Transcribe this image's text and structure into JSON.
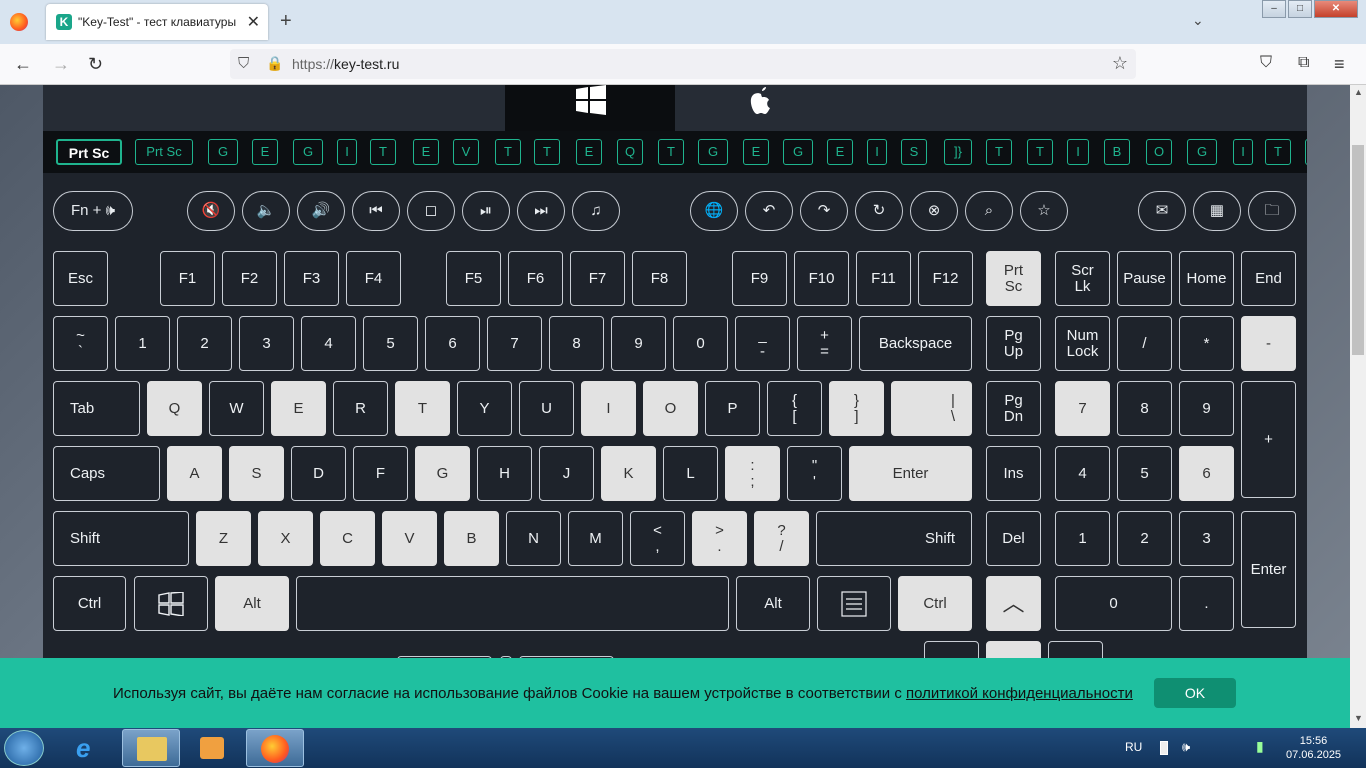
{
  "browser": {
    "tab_title": "\"Key-Test\" - тест клавиатуры",
    "tab_favicon": "K",
    "url_proto": "https://",
    "url_host": "key-test.ru"
  },
  "keystrip": [
    "Prt Sc",
    "Prt Sc",
    "G",
    "E",
    "G",
    "I",
    "T",
    "E",
    "V",
    "T",
    "T",
    "E",
    "Q",
    "T",
    "G",
    "E",
    "G",
    "E",
    "I",
    "S",
    "]}",
    "T",
    "T",
    "I",
    "B",
    "O",
    "G",
    "I",
    "T"
  ],
  "fn_label": "Fn + 🕪",
  "function_row": [
    {
      "label": "Esc"
    },
    {
      "label": "F1"
    },
    {
      "label": "F2"
    },
    {
      "label": "F3"
    },
    {
      "label": "F4"
    },
    {
      "label": "F5"
    },
    {
      "label": "F6"
    },
    {
      "label": "F7"
    },
    {
      "label": "F8"
    },
    {
      "label": "F9"
    },
    {
      "label": "F10"
    },
    {
      "label": "F11"
    },
    {
      "label": "F12"
    },
    {
      "label": "Prt\nSc"
    },
    {
      "label": "Scr\nLk"
    },
    {
      "label": "Pause"
    },
    {
      "label": "Home"
    },
    {
      "label": "End"
    }
  ],
  "number_row": [
    "~\n`",
    "1",
    "2",
    "3",
    "4",
    "5",
    "6",
    "7",
    "8",
    "9",
    "0",
    "_\n-",
    "+\n=",
    "Backspace",
    "Pg\nUp",
    "Num\nLock",
    "/",
    "*",
    "-"
  ],
  "q_row": [
    "Tab",
    "Q",
    "W",
    "E",
    "R",
    "T",
    "Y",
    "U",
    "I",
    "O",
    "P",
    "{\n[",
    "}\n]",
    "|\n\\",
    "Pg\nDn",
    "7",
    "8",
    "9",
    "+"
  ],
  "a_row": [
    "Caps",
    "A",
    "S",
    "D",
    "F",
    "G",
    "H",
    "J",
    "K",
    "L",
    ":\n;",
    "\"\n'",
    "Enter",
    "Ins",
    "4",
    "5",
    "6"
  ],
  "z_row": [
    "Shift",
    "Z",
    "X",
    "C",
    "V",
    "B",
    "N",
    "M",
    "<\n,",
    ">\n.",
    "?\n/",
    "Shift",
    "Del",
    "1",
    "2",
    "3",
    "Enter"
  ],
  "bottom_row": [
    "Ctrl",
    "",
    "Alt",
    "",
    "Alt",
    "",
    "Ctrl",
    "",
    "0",
    "."
  ],
  "cookie": {
    "text": "Используя сайт, вы даёте нам согласие на использование файлов Cookie на вашем устройстве в соответствии с ",
    "link": "политикой конфиденциальности",
    "ok": "OK"
  },
  "taskbar": {
    "lang": "RU",
    "time": "15:56",
    "date": "07.06.2025"
  },
  "colors": {
    "accent": "#1fb48e",
    "cookie_bg": "#1fc0a0",
    "pressed": "#e2e2e2",
    "keyboard_bg": "#1e232b"
  }
}
